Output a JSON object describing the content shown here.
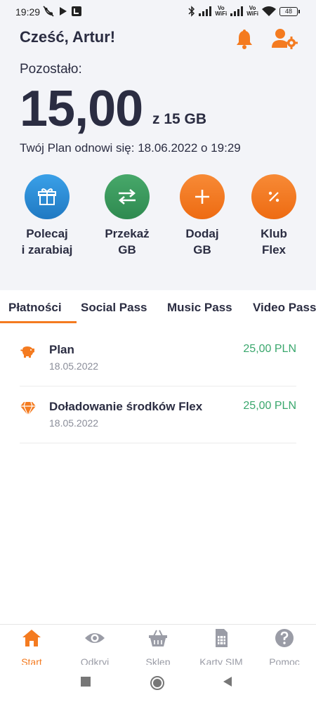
{
  "status_bar": {
    "time": "19:29",
    "battery": "48",
    "vowifi_top": "Vo",
    "vowifi_bottom": "WiFi"
  },
  "header": {
    "greeting": "Cześć, Artur!",
    "icons": [
      "bell-icon",
      "user-settings-icon"
    ]
  },
  "balance": {
    "label": "Pozostało:",
    "amount": "15,00",
    "unit": "z 15 GB",
    "renew_text": "Twój Plan odnowi się: 18.06.2022 o 19:29"
  },
  "actions": [
    {
      "line1": "Polecaj",
      "line2": "i zarabiaj",
      "icon": "gift-icon",
      "color": "#2e8fd6"
    },
    {
      "line1": "Przekaż",
      "line2": "GB",
      "icon": "transfer-icon",
      "color": "#3b9a5c"
    },
    {
      "line1": "Dodaj",
      "line2": "GB",
      "icon": "plus-icon",
      "color": "#f47b20"
    },
    {
      "line1": "Klub",
      "line2": "Flex",
      "icon": "percent-icon",
      "color": "#f47b20"
    }
  ],
  "tabs": [
    "Płatności",
    "Social Pass",
    "Music Pass",
    "Video Pass"
  ],
  "active_tab": "Płatności",
  "payments": [
    {
      "title": "Plan",
      "date": "18.05.2022",
      "amount": "25,00 PLN",
      "icon": "piggy-bank-icon"
    },
    {
      "title": "Doładowanie środków Flex",
      "date": "18.05.2022",
      "amount": "25,00 PLN",
      "icon": "diamond-icon"
    }
  ],
  "bottom_nav": [
    {
      "label": "Start",
      "icon": "home-icon",
      "active": true
    },
    {
      "label": "Odkryj",
      "icon": "eye-icon",
      "active": false
    },
    {
      "label": "Sklep",
      "icon": "basket-icon",
      "active": false
    },
    {
      "label": "Karty SIM",
      "icon": "sim-card-icon",
      "active": false
    },
    {
      "label": "Pomoc",
      "icon": "help-icon",
      "active": false
    }
  ],
  "colors": {
    "accent": "#f47b20",
    "text": "#2b2d42",
    "positive": "#3aa76d",
    "background_top": "#f3f4f8"
  }
}
